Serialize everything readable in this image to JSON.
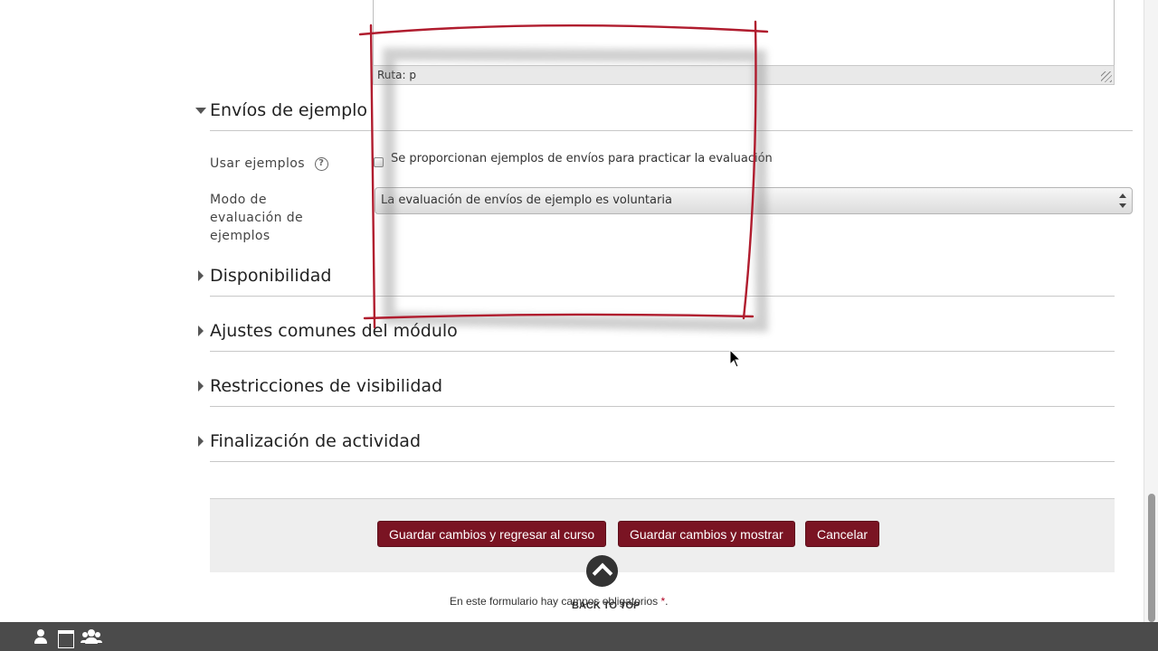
{
  "editor": {
    "path_label": "Ruta: p"
  },
  "sections": {
    "example_submissions": "Envíos de ejemplo",
    "availability": "Disponibilidad",
    "common_module_settings": "Ajustes comunes del módulo",
    "restrict_access": "Restricciones de visibilidad",
    "activity_completion": "Finalización de actividad"
  },
  "form": {
    "use_examples_label": "Usar ejemplos",
    "use_examples_checkbox_text": "Se proporcionan ejemplos de envíos para practicar la evaluación",
    "use_examples_checked": false,
    "example_mode_label": "Modo de evaluación de ejemplos",
    "example_mode_value": "La evaluación de envíos de ejemplo es voluntaria",
    "help_glyph": "?"
  },
  "actions": {
    "save_return": "Guardar cambios y regresar al curso",
    "save_display": "Guardar cambios y mostrar",
    "cancel": "Cancelar"
  },
  "back_to_top": "BACK TO TOP",
  "required_note": {
    "text": "En este formulario hay campos obligatorios",
    "star": "*",
    "end": "."
  },
  "colors": {
    "button_bg": "#7a1423",
    "footer_bg": "#4b4b4b",
    "annotation": "#b01c2e"
  },
  "footer": {
    "icons": [
      "person-icon",
      "calendar-icon",
      "users-icon"
    ]
  }
}
